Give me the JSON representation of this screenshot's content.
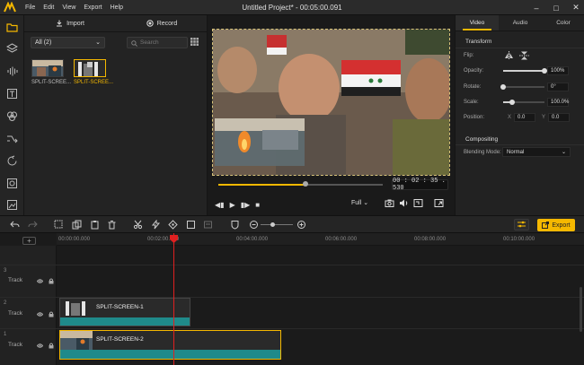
{
  "app": {
    "menu": [
      "File",
      "Edit",
      "View",
      "Export",
      "Help"
    ],
    "window_title": "Untitled Project* - 00:05:00.091"
  },
  "left_nav": [
    "folder-icon",
    "layers-icon",
    "audio-icon",
    "text-icon",
    "effects-icon",
    "transitions-icon",
    "overlays-icon",
    "filter-icon",
    "elements-icon"
  ],
  "media": {
    "import_label": "Import",
    "record_label": "Record",
    "filter_value": "All (2)",
    "search_placeholder": "Search",
    "items": [
      {
        "label": "SPLIT-SCREE..."
      },
      {
        "label": "SPLIT-SCREE..."
      }
    ]
  },
  "preview": {
    "timecode": "00 : 02 : 35 . 530",
    "fit_value": "Full",
    "progress": 0.53
  },
  "properties": {
    "tabs": [
      "Video",
      "Audio",
      "Color"
    ],
    "transform_title": "Transform",
    "flip_label": "Flip:",
    "opacity_label": "Opacity:",
    "opacity_value": "100%",
    "opacity_level": 1.0,
    "rotate_label": "Rotate:",
    "rotate_value": "0°",
    "rotate_level": 0.0,
    "scale_label": "Scale:",
    "scale_value": "100.0%",
    "scale_level": 0.22,
    "position_label": "Position:",
    "pos_x_label": "X",
    "pos_x_value": "0.0",
    "pos_y_label": "Y",
    "pos_y_value": "0.0",
    "compositing_title": "Compositing",
    "blending_label": "Blending Mode:",
    "blending_value": "Normal"
  },
  "toolbar": {
    "export_label": "Export"
  },
  "timeline": {
    "ticks": [
      "00:00:00.000",
      "00:02:00.000",
      "00:04:00.000",
      "00:06:00.000",
      "00:08:00.000",
      "00:10:00.000"
    ],
    "tracks": [
      {
        "number": "3",
        "name": "Track"
      },
      {
        "number": "2",
        "name": "Track",
        "clip": "SPLIT-SCREEN-1"
      },
      {
        "number": "1",
        "name": "Track",
        "clip": "SPLIT-SCREEN-2"
      }
    ]
  },
  "colors": {
    "accent": "#f5b800",
    "clip": "#1f8a8a",
    "playhead": "#e02020"
  }
}
